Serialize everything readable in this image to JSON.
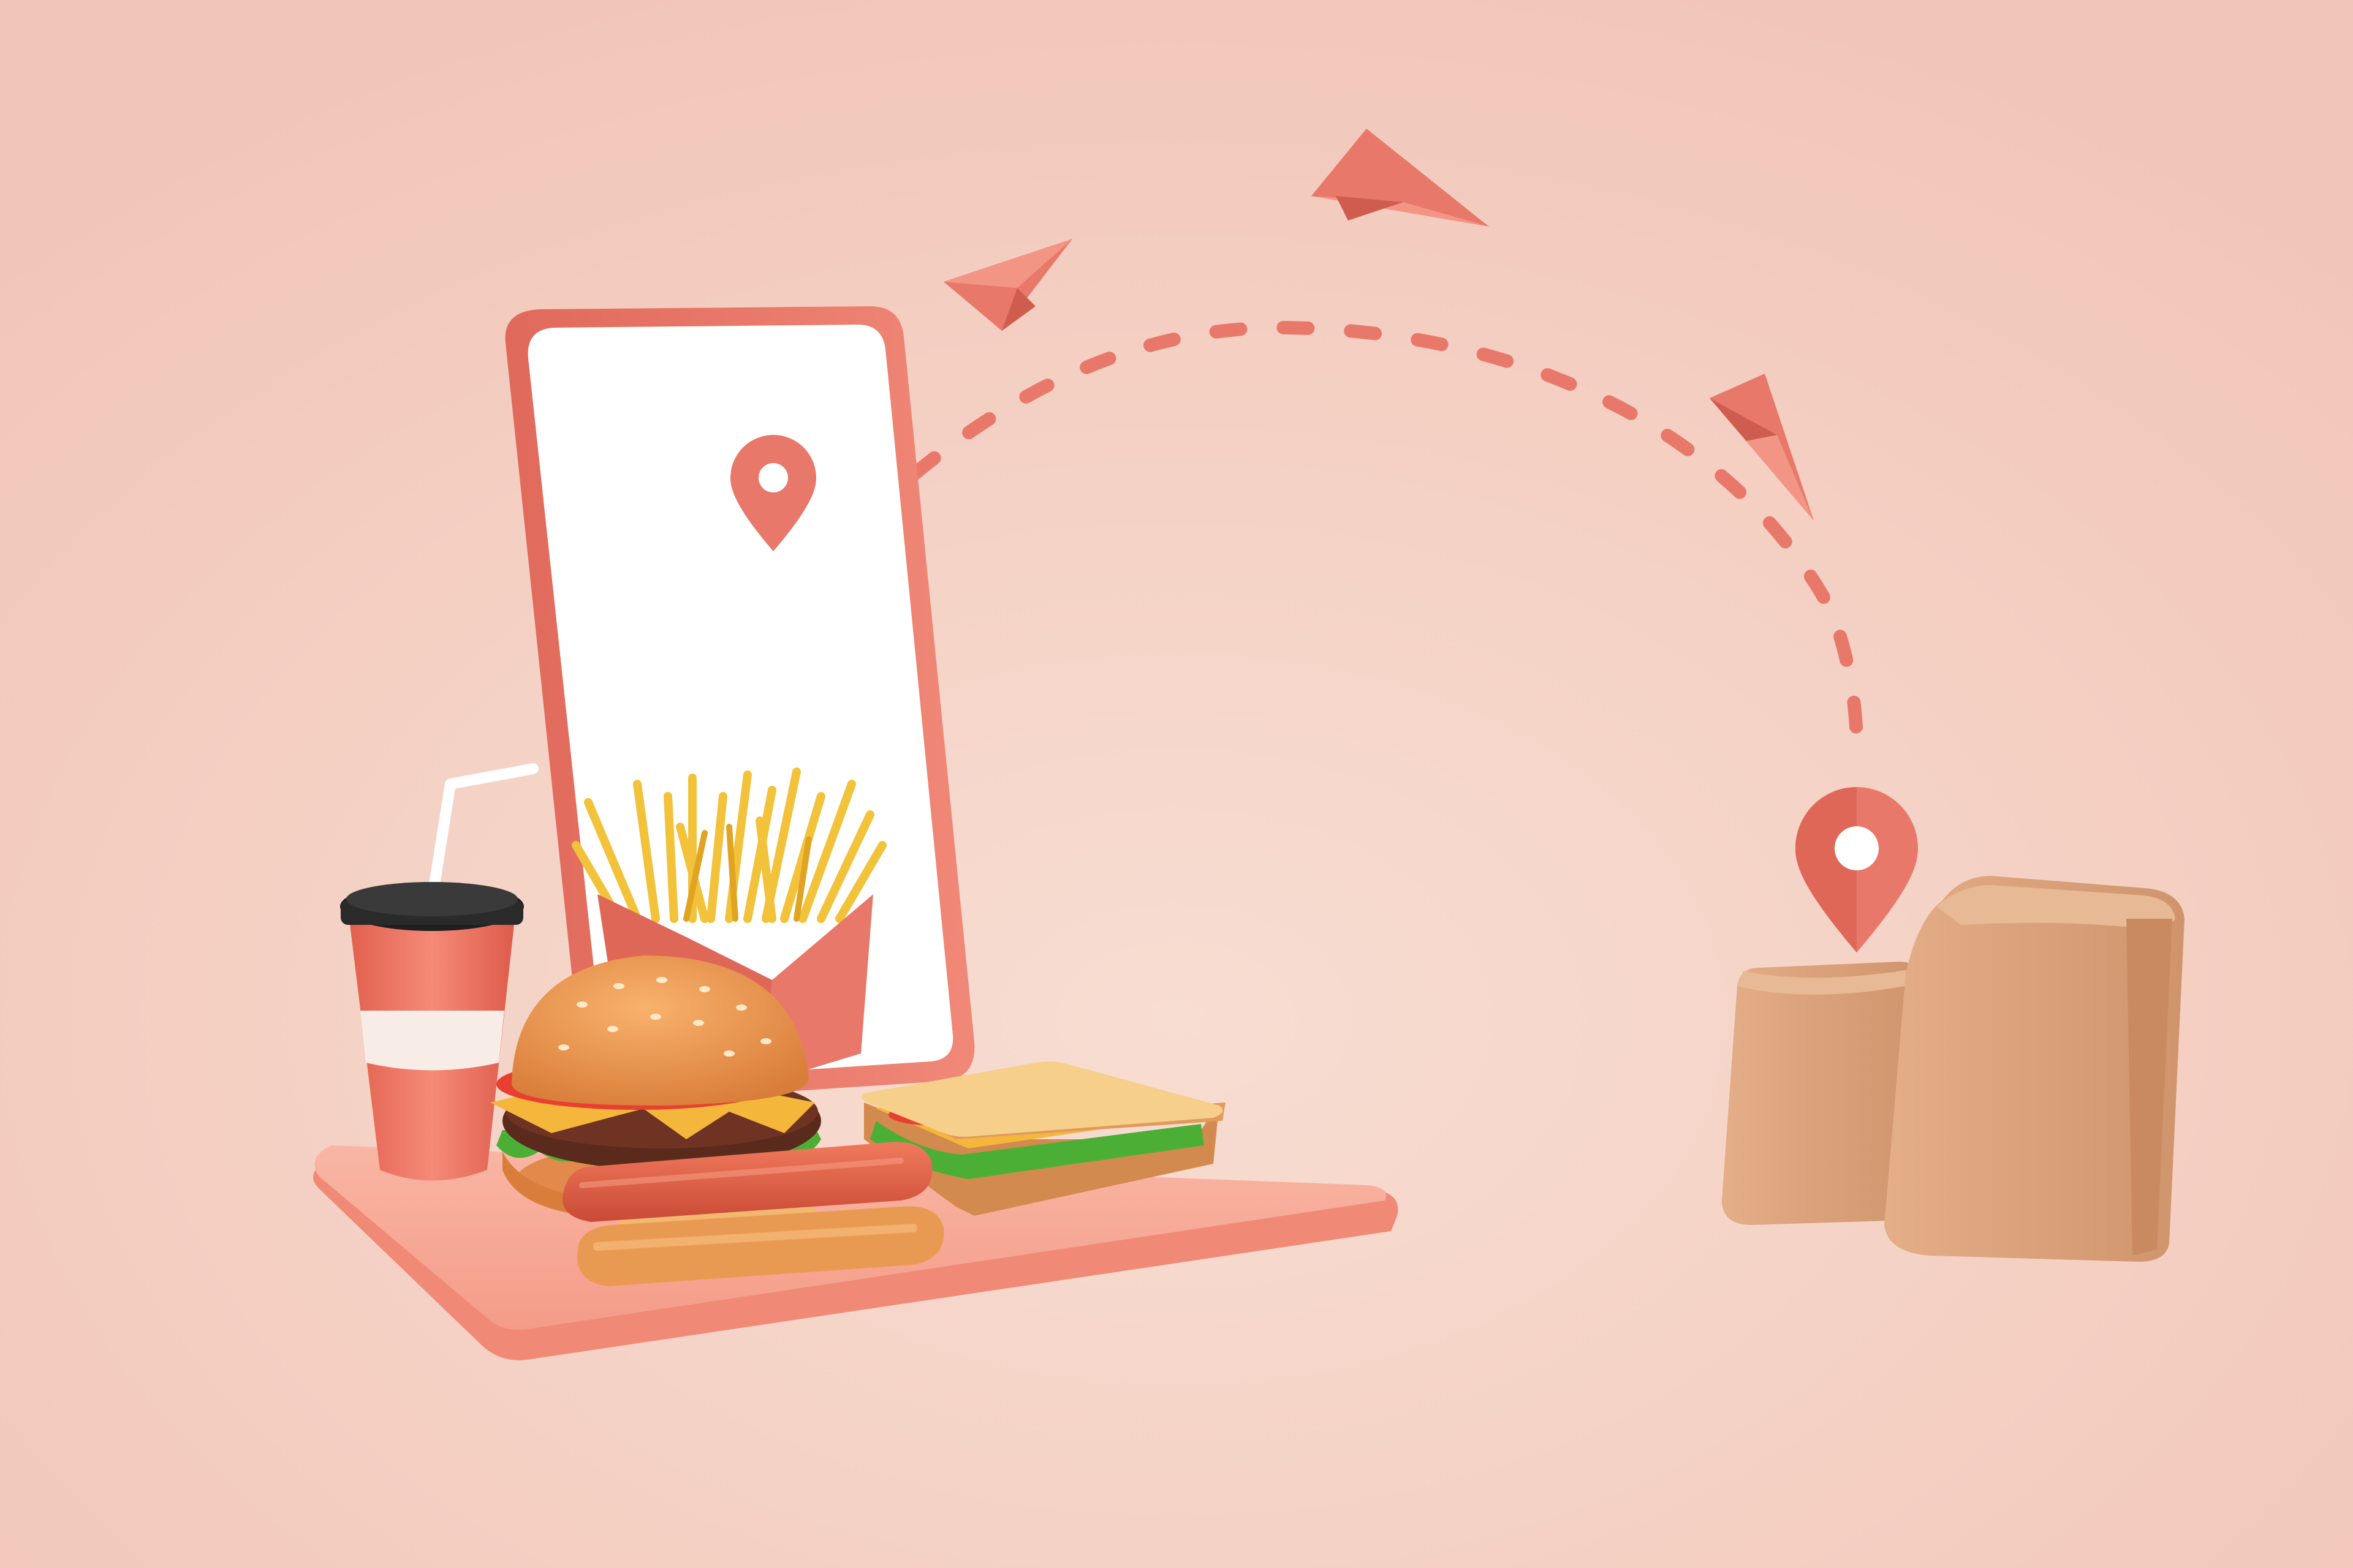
{
  "scene": {
    "description": "",
    "elements": [
      "smartphone",
      "location-pin-start",
      "location-pin-end",
      "dashed-route",
      "paper-plane",
      "paper-plane",
      "paper-plane",
      "soda-cup",
      "french-fries",
      "burger",
      "sandwich",
      "hot-dog",
      "serving-tray",
      "paper-bag",
      "paper-bag"
    ]
  },
  "colors": {
    "background": "#f4cfc2",
    "accent": "#e8796a",
    "phone_screen": "#ffffff",
    "bag": "#d9a27c",
    "fries": "#f2c23a"
  }
}
